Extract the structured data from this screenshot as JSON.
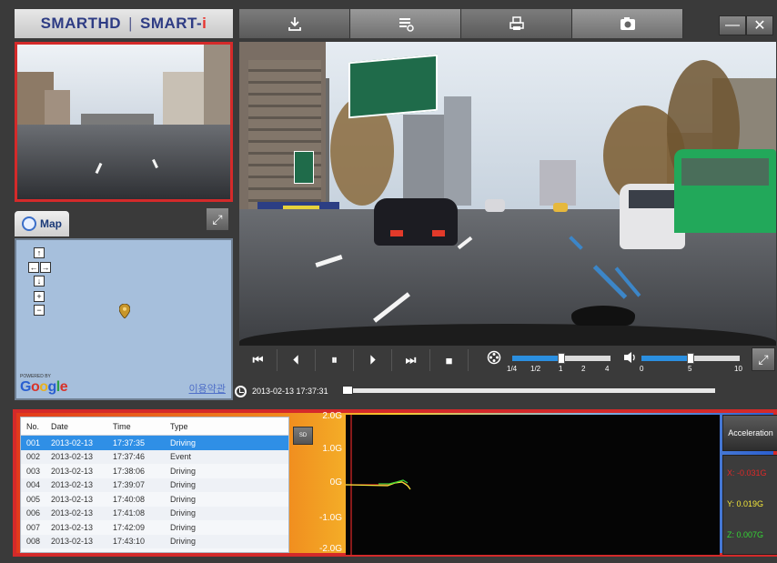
{
  "brand": {
    "left": "SMARTHD",
    "separator": "|",
    "right": "SMART-",
    "right_accent": "i"
  },
  "toolbar": {
    "buttons": [
      {
        "name": "download-icon"
      },
      {
        "name": "settings-list-icon"
      },
      {
        "name": "print-icon"
      },
      {
        "name": "camera-icon"
      }
    ],
    "minimize": "—",
    "close": "✕"
  },
  "map": {
    "tab_label": "Map",
    "nav": [
      "↑",
      "←",
      "→",
      "↓",
      "+",
      "−"
    ],
    "powered_by": "POWERED BY",
    "google": "Google",
    "terms": "이용약관"
  },
  "playback": {
    "controls": [
      "⏮",
      "⏴",
      "⏸",
      "⏵",
      "⏭",
      "■"
    ],
    "speed_ticks": [
      "1/4",
      "1/2",
      "1",
      "2",
      "4"
    ],
    "volume_ticks": [
      "0",
      "5",
      "10"
    ],
    "timestamp": "2013-02-13 17:37:31",
    "speed_level": 0.5,
    "volume_level": 0.5,
    "timeline_progress": 0.0
  },
  "events": {
    "columns": [
      "No.",
      "Date",
      "Time",
      "Type"
    ],
    "rows": [
      {
        "no": "001",
        "date": "2013-02-13",
        "time": "17:37:35",
        "type": "Driving",
        "selected": true
      },
      {
        "no": "002",
        "date": "2013-02-13",
        "time": "17:37:46",
        "type": "Event"
      },
      {
        "no": "003",
        "date": "2013-02-13",
        "time": "17:38:06",
        "type": "Driving"
      },
      {
        "no": "004",
        "date": "2013-02-13",
        "time": "17:39:07",
        "type": "Driving"
      },
      {
        "no": "005",
        "date": "2013-02-13",
        "time": "17:40:08",
        "type": "Driving"
      },
      {
        "no": "006",
        "date": "2013-02-13",
        "time": "17:41:08",
        "type": "Driving"
      },
      {
        "no": "007",
        "date": "2013-02-13",
        "time": "17:42:09",
        "type": "Driving"
      },
      {
        "no": "008",
        "date": "2013-02-13",
        "time": "17:43:10",
        "type": "Driving"
      }
    ],
    "sd_label": "SD"
  },
  "graph": {
    "y_labels": [
      "2.0G",
      "1.0G",
      "0G",
      "-1.0G",
      "-2.0G"
    ],
    "accel_label": "Acceleration",
    "x_value": "X: -0.031G",
    "y_value": "Y: 0.019G",
    "z_value": "Z: 0.007G",
    "colors": {
      "x": "#e02828",
      "y": "#f2e63a",
      "z": "#35d435"
    }
  }
}
